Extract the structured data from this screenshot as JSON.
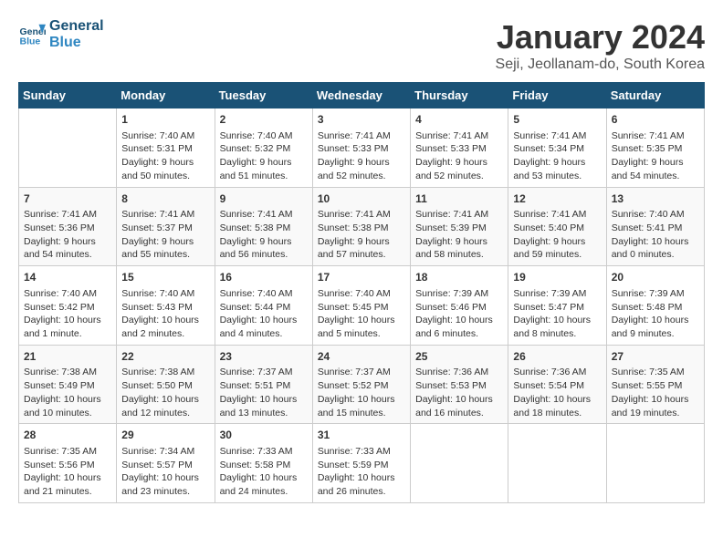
{
  "logo": {
    "line1": "General",
    "line2": "Blue"
  },
  "title": "January 2024",
  "subtitle": "Seji, Jeollanam-do, South Korea",
  "days_of_week": [
    "Sunday",
    "Monday",
    "Tuesday",
    "Wednesday",
    "Thursday",
    "Friday",
    "Saturday"
  ],
  "weeks": [
    [
      {
        "day": "",
        "sunrise": "",
        "sunset": "",
        "daylight": ""
      },
      {
        "day": "1",
        "sunrise": "7:40 AM",
        "sunset": "5:31 PM",
        "daylight": "9 hours and 50 minutes."
      },
      {
        "day": "2",
        "sunrise": "7:40 AM",
        "sunset": "5:32 PM",
        "daylight": "9 hours and 51 minutes."
      },
      {
        "day": "3",
        "sunrise": "7:41 AM",
        "sunset": "5:33 PM",
        "daylight": "9 hours and 52 minutes."
      },
      {
        "day": "4",
        "sunrise": "7:41 AM",
        "sunset": "5:33 PM",
        "daylight": "9 hours and 52 minutes."
      },
      {
        "day": "5",
        "sunrise": "7:41 AM",
        "sunset": "5:34 PM",
        "daylight": "9 hours and 53 minutes."
      },
      {
        "day": "6",
        "sunrise": "7:41 AM",
        "sunset": "5:35 PM",
        "daylight": "9 hours and 54 minutes."
      }
    ],
    [
      {
        "day": "7",
        "sunrise": "7:41 AM",
        "sunset": "5:36 PM",
        "daylight": "9 hours and 54 minutes."
      },
      {
        "day": "8",
        "sunrise": "7:41 AM",
        "sunset": "5:37 PM",
        "daylight": "9 hours and 55 minutes."
      },
      {
        "day": "9",
        "sunrise": "7:41 AM",
        "sunset": "5:38 PM",
        "daylight": "9 hours and 56 minutes."
      },
      {
        "day": "10",
        "sunrise": "7:41 AM",
        "sunset": "5:38 PM",
        "daylight": "9 hours and 57 minutes."
      },
      {
        "day": "11",
        "sunrise": "7:41 AM",
        "sunset": "5:39 PM",
        "daylight": "9 hours and 58 minutes."
      },
      {
        "day": "12",
        "sunrise": "7:41 AM",
        "sunset": "5:40 PM",
        "daylight": "9 hours and 59 minutes."
      },
      {
        "day": "13",
        "sunrise": "7:40 AM",
        "sunset": "5:41 PM",
        "daylight": "10 hours and 0 minutes."
      }
    ],
    [
      {
        "day": "14",
        "sunrise": "7:40 AM",
        "sunset": "5:42 PM",
        "daylight": "10 hours and 1 minute."
      },
      {
        "day": "15",
        "sunrise": "7:40 AM",
        "sunset": "5:43 PM",
        "daylight": "10 hours and 2 minutes."
      },
      {
        "day": "16",
        "sunrise": "7:40 AM",
        "sunset": "5:44 PM",
        "daylight": "10 hours and 4 minutes."
      },
      {
        "day": "17",
        "sunrise": "7:40 AM",
        "sunset": "5:45 PM",
        "daylight": "10 hours and 5 minutes."
      },
      {
        "day": "18",
        "sunrise": "7:39 AM",
        "sunset": "5:46 PM",
        "daylight": "10 hours and 6 minutes."
      },
      {
        "day": "19",
        "sunrise": "7:39 AM",
        "sunset": "5:47 PM",
        "daylight": "10 hours and 8 minutes."
      },
      {
        "day": "20",
        "sunrise": "7:39 AM",
        "sunset": "5:48 PM",
        "daylight": "10 hours and 9 minutes."
      }
    ],
    [
      {
        "day": "21",
        "sunrise": "7:38 AM",
        "sunset": "5:49 PM",
        "daylight": "10 hours and 10 minutes."
      },
      {
        "day": "22",
        "sunrise": "7:38 AM",
        "sunset": "5:50 PM",
        "daylight": "10 hours and 12 minutes."
      },
      {
        "day": "23",
        "sunrise": "7:37 AM",
        "sunset": "5:51 PM",
        "daylight": "10 hours and 13 minutes."
      },
      {
        "day": "24",
        "sunrise": "7:37 AM",
        "sunset": "5:52 PM",
        "daylight": "10 hours and 15 minutes."
      },
      {
        "day": "25",
        "sunrise": "7:36 AM",
        "sunset": "5:53 PM",
        "daylight": "10 hours and 16 minutes."
      },
      {
        "day": "26",
        "sunrise": "7:36 AM",
        "sunset": "5:54 PM",
        "daylight": "10 hours and 18 minutes."
      },
      {
        "day": "27",
        "sunrise": "7:35 AM",
        "sunset": "5:55 PM",
        "daylight": "10 hours and 19 minutes."
      }
    ],
    [
      {
        "day": "28",
        "sunrise": "7:35 AM",
        "sunset": "5:56 PM",
        "daylight": "10 hours and 21 minutes."
      },
      {
        "day": "29",
        "sunrise": "7:34 AM",
        "sunset": "5:57 PM",
        "daylight": "10 hours and 23 minutes."
      },
      {
        "day": "30",
        "sunrise": "7:33 AM",
        "sunset": "5:58 PM",
        "daylight": "10 hours and 24 minutes."
      },
      {
        "day": "31",
        "sunrise": "7:33 AM",
        "sunset": "5:59 PM",
        "daylight": "10 hours and 26 minutes."
      },
      {
        "day": "",
        "sunrise": "",
        "sunset": "",
        "daylight": ""
      },
      {
        "day": "",
        "sunrise": "",
        "sunset": "",
        "daylight": ""
      },
      {
        "day": "",
        "sunrise": "",
        "sunset": "",
        "daylight": ""
      }
    ]
  ]
}
